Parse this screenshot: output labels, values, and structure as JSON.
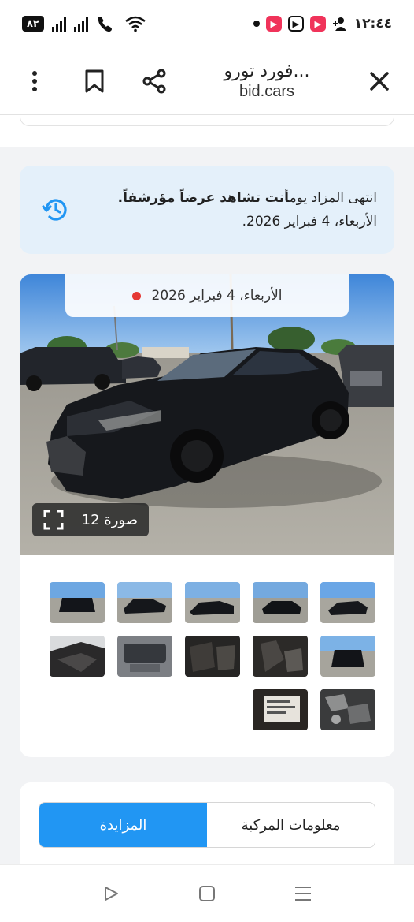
{
  "status_bar": {
    "time": "١٢:٤٤",
    "battery": "٨٢"
  },
  "browser": {
    "title": "فورد تورو...",
    "url": "bid.cars",
    "icons": [
      "close-icon",
      "share-icon",
      "bookmark-icon",
      "more-vert-icon"
    ]
  },
  "notice": {
    "line1_prefix": "انتهى المزاد يوم",
    "line1_bold": "أنت تشاهد عرضاً مؤرشفاً.",
    "line2": "الأربعاء، 4 فبراير 2026.",
    "icon": "history-icon"
  },
  "gallery": {
    "date_label": "الأربعاء، 4 فبراير 2026",
    "photo_count": "12 صورة",
    "thumb_count": 12
  },
  "tabs": {
    "active": "المزايدة",
    "inactive": "معلومات المركبة"
  },
  "colors": {
    "accent": "#2196f3",
    "notice_bg": "#e4f0fa",
    "live_dot": "#e53935"
  }
}
